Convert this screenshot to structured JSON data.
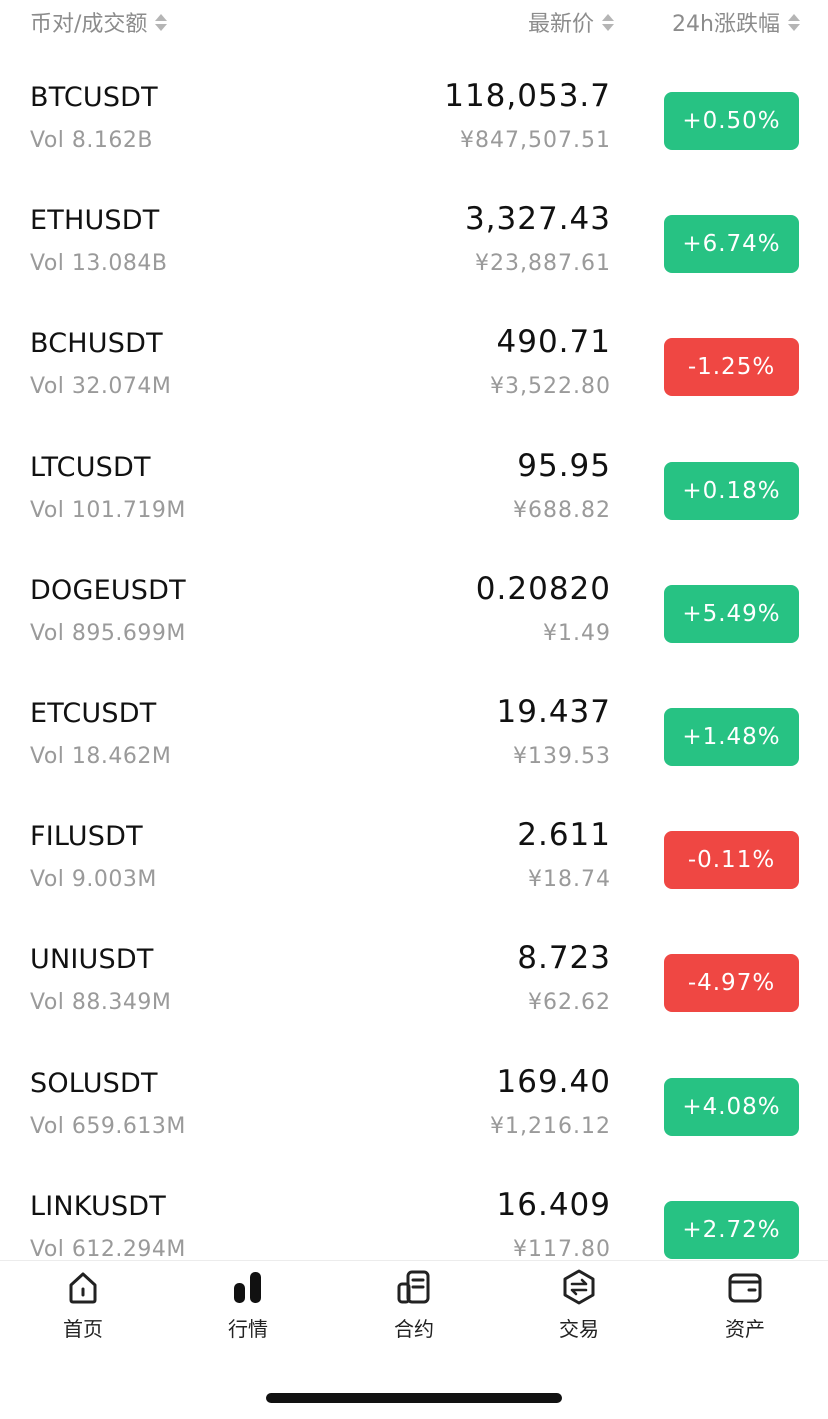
{
  "header": {
    "pair_volume": "币对/成交额",
    "latest_price": "最新价",
    "change_24h": "24h涨跌幅"
  },
  "rows": [
    {
      "symbol": "BTCUSDT",
      "vol": "Vol 8.162B",
      "price": "118,053.7",
      "cny": "¥847,507.51",
      "change": "+0.50%",
      "dir": "up"
    },
    {
      "symbol": "ETHUSDT",
      "vol": "Vol 13.084B",
      "price": "3,327.43",
      "cny": "¥23,887.61",
      "change": "+6.74%",
      "dir": "up"
    },
    {
      "symbol": "BCHUSDT",
      "vol": "Vol 32.074M",
      "price": "490.71",
      "cny": "¥3,522.80",
      "change": "-1.25%",
      "dir": "down"
    },
    {
      "symbol": "LTCUSDT",
      "vol": "Vol 101.719M",
      "price": "95.95",
      "cny": "¥688.82",
      "change": "+0.18%",
      "dir": "up"
    },
    {
      "symbol": "DOGEUSDT",
      "vol": "Vol 895.699M",
      "price": "0.20820",
      "cny": "¥1.49",
      "change": "+5.49%",
      "dir": "up"
    },
    {
      "symbol": "ETCUSDT",
      "vol": "Vol 18.462M",
      "price": "19.437",
      "cny": "¥139.53",
      "change": "+1.48%",
      "dir": "up"
    },
    {
      "symbol": "FILUSDT",
      "vol": "Vol 9.003M",
      "price": "2.611",
      "cny": "¥18.74",
      "change": "-0.11%",
      "dir": "down"
    },
    {
      "symbol": "UNIUSDT",
      "vol": "Vol 88.349M",
      "price": "8.723",
      "cny": "¥62.62",
      "change": "-4.97%",
      "dir": "down"
    },
    {
      "symbol": "SOLUSDT",
      "vol": "Vol 659.613M",
      "price": "169.40",
      "cny": "¥1,216.12",
      "change": "+4.08%",
      "dir": "up"
    },
    {
      "symbol": "LINKUSDT",
      "vol": "Vol 612.294M",
      "price": "16.409",
      "cny": "¥117.80",
      "change": "+2.72%",
      "dir": "up"
    }
  ],
  "nav": {
    "home": "首页",
    "market": "行情",
    "futures": "合约",
    "trade": "交易",
    "assets": "资产"
  },
  "colors": {
    "up": "#27c283",
    "down": "#ef4743"
  }
}
